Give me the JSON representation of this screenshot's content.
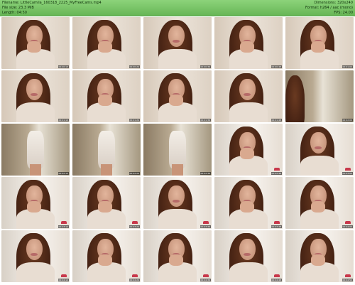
{
  "header": {
    "filename": "Filename: LittleCamila_160318_2225_MyFreeCams.mp4",
    "filesize": "File size: 23.3 MiB",
    "length": "Length: 04:50",
    "dimensions": "Dimensions: 320x240",
    "format": "Format: h264 / aac (mono)",
    "fps": "FPS: 24.00"
  },
  "colors": {
    "header_bg": "#7cc76b",
    "thumb_wall": "#e9dfd4",
    "thumb_bright_wall": "#f6f3ee",
    "timestamp_bg": "#000000"
  },
  "thumbnails": [
    {
      "timestamp": "00:00:13",
      "scene": "face"
    },
    {
      "timestamp": "00:00:24",
      "scene": "face"
    },
    {
      "timestamp": "00:00:36",
      "scene": "face"
    },
    {
      "timestamp": "00:00:48",
      "scene": "face"
    },
    {
      "timestamp": "00:01:00",
      "scene": "face"
    },
    {
      "timestamp": "00:01:12",
      "scene": "face"
    },
    {
      "timestamp": "00:01:24",
      "scene": "face"
    },
    {
      "timestamp": "00:01:36",
      "scene": "face"
    },
    {
      "timestamp": "00:01:48",
      "scene": "face"
    },
    {
      "timestamp": "00:02:00",
      "scene": "room"
    },
    {
      "timestamp": "00:02:12",
      "scene": "body"
    },
    {
      "timestamp": "00:02:24",
      "scene": "body"
    },
    {
      "timestamp": "00:02:36",
      "scene": "body"
    },
    {
      "timestamp": "00:02:48",
      "scene": "face-bright"
    },
    {
      "timestamp": "00:03:00",
      "scene": "face-bright"
    },
    {
      "timestamp": "00:03:12",
      "scene": "face-bright"
    },
    {
      "timestamp": "00:03:24",
      "scene": "face-bright"
    },
    {
      "timestamp": "00:03:36",
      "scene": "face-bright"
    },
    {
      "timestamp": "00:03:48",
      "scene": "face-bright"
    },
    {
      "timestamp": "00:04:00",
      "scene": "face-bright"
    },
    {
      "timestamp": "00:04:12",
      "scene": "face-bright"
    },
    {
      "timestamp": "00:04:24",
      "scene": "face-bright"
    },
    {
      "timestamp": "00:04:36",
      "scene": "face-bright"
    },
    {
      "timestamp": "00:04:48",
      "scene": "face-bright"
    },
    {
      "timestamp": "00:04:50",
      "scene": "face-bright"
    }
  ]
}
